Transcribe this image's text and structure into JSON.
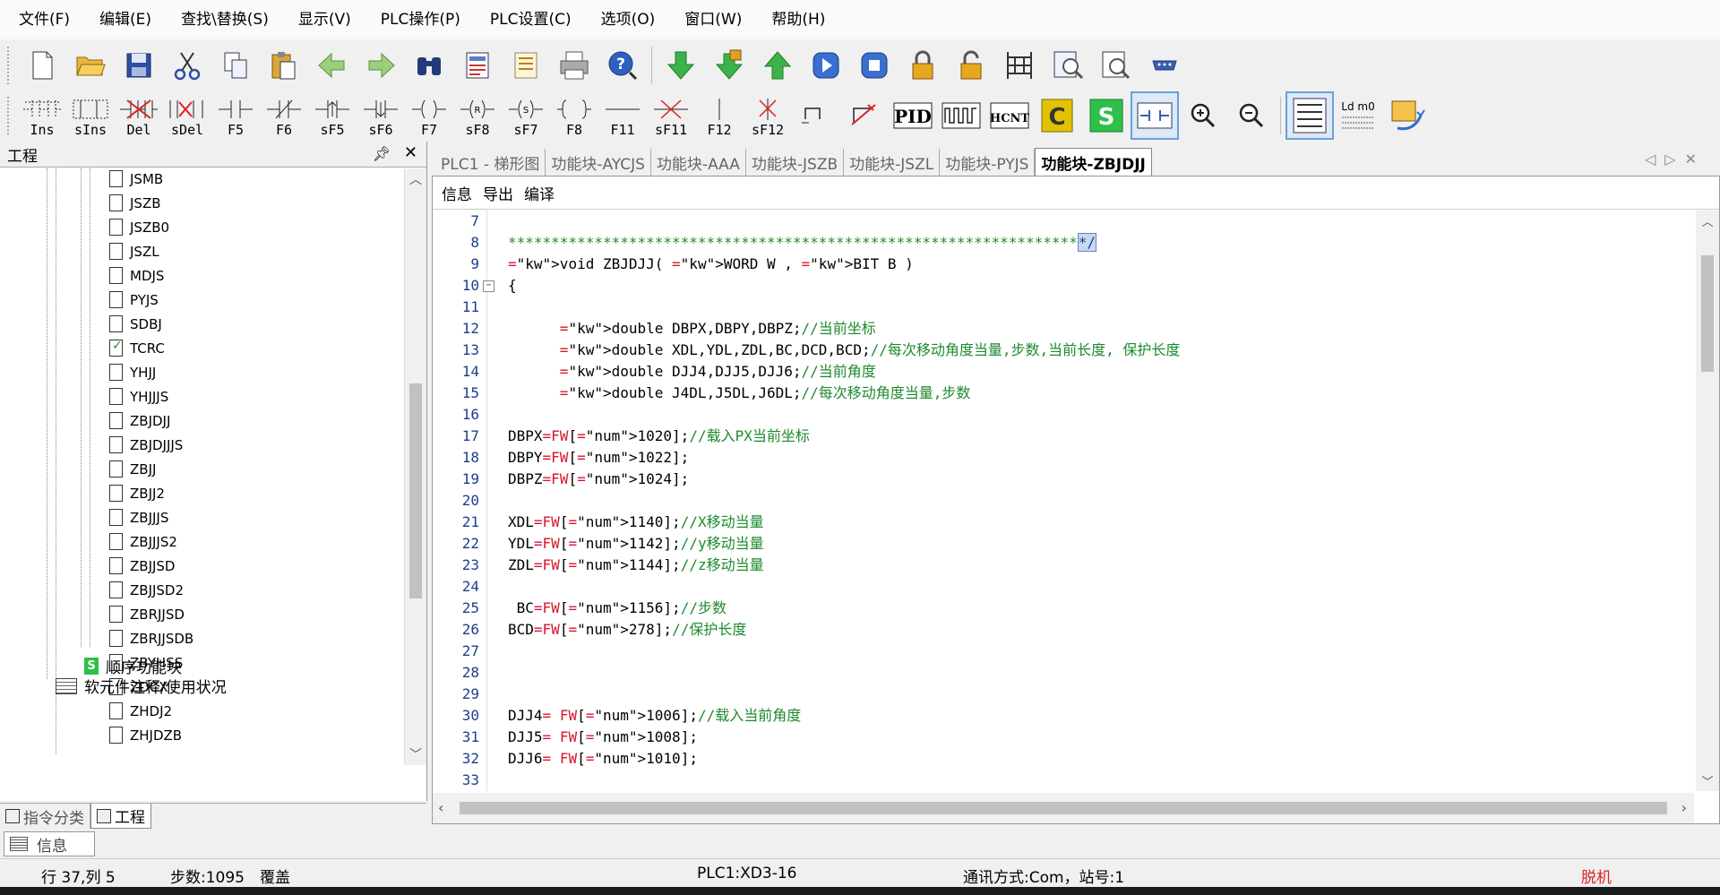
{
  "menu": [
    "文件(F)",
    "编辑(E)",
    "查找\\替换(S)",
    "显示(V)",
    "PLC操作(P)",
    "PLC设置(C)",
    "选项(O)",
    "窗口(W)",
    "帮助(H)"
  ],
  "ladder_keys": [
    "Ins",
    "sIns",
    "Del",
    "sDel",
    "F5",
    "F6",
    "sF5",
    "sF6",
    "F7",
    "sF8",
    "sF7",
    "F8",
    "F11",
    "sF11",
    "F12",
    "sF12"
  ],
  "toolbar2_text": {
    "pid": "PID",
    "hcnt": "HCNT",
    "c": "C",
    "s": "S",
    "ld": "Ld m0"
  },
  "project_panel": {
    "title": "工程",
    "items": [
      "JSMB",
      "JSZB",
      "JSZB0",
      "JSZL",
      "MDJS",
      "PYJS",
      "SDBJ",
      "TCRC",
      "YHJJ",
      "YHJJJS",
      "ZBJDJJ",
      "ZBJDJJJS",
      "ZBJJ",
      "ZBJJ2",
      "ZBJJJS",
      "ZBJJJS2",
      "ZBJJSD",
      "ZBJJSD2",
      "ZBRJJSD",
      "ZBRJJSDB",
      "ZBYHSS",
      "ZDCX",
      "ZHDJ2",
      "ZHJDZB"
    ],
    "seq_block": "顺序功能块",
    "comments": "软元件注释/使用状况",
    "tabs": [
      "指令分类",
      "工程"
    ]
  },
  "doc_tabs": [
    "PLC1 - 梯形图",
    "功能块-AYCJS",
    "功能块-AAA",
    "功能块-JSZB",
    "功能块-JSZL",
    "功能块-PYJS",
    "功能块-ZBJDJJ"
  ],
  "editor_menu": [
    "信息",
    "导出",
    "编译"
  ],
  "code_lines": [
    {
      "n": "7",
      "t": ""
    },
    {
      "n": "8",
      "t": "******************************************************************"
    },
    {
      "n": "9",
      "t": "void ZBJDJJ( WORD W , BIT B )"
    },
    {
      "n": "10",
      "t": "{"
    },
    {
      "n": "11",
      "t": ""
    },
    {
      "n": "12",
      "t": "      double DBPX,DBPY,DBPZ;//当前坐标"
    },
    {
      "n": "13",
      "t": "      double XDL,YDL,ZDL,BC,DCD,BCD;//每次移动角度当量,步数,当前长度, 保护长度"
    },
    {
      "n": "14",
      "t": "      double DJJ4,DJJ5,DJJ6;//当前角度"
    },
    {
      "n": "15",
      "t": "      double J4DL,J5DL,J6DL;//每次移动角度当量,步数"
    },
    {
      "n": "16",
      "t": ""
    },
    {
      "n": "17",
      "t": "DBPX=FW[1020];//载入PX当前坐标"
    },
    {
      "n": "18",
      "t": "DBPY=FW[1022];"
    },
    {
      "n": "19",
      "t": "DBPZ=FW[1024];"
    },
    {
      "n": "20",
      "t": ""
    },
    {
      "n": "21",
      "t": "XDL=FW[1140];//X移动当量"
    },
    {
      "n": "22",
      "t": "YDL=FW[1142];//y移动当量"
    },
    {
      "n": "23",
      "t": "ZDL=FW[1144];//z移动当量"
    },
    {
      "n": "24",
      "t": ""
    },
    {
      "n": "25",
      "t": " BC=FW[1156];//步数"
    },
    {
      "n": "26",
      "t": "BCD=FW[278];//保护长度"
    },
    {
      "n": "27",
      "t": ""
    },
    {
      "n": "28",
      "t": ""
    },
    {
      "n": "29",
      "t": ""
    },
    {
      "n": "30",
      "t": "DJJ4= FW[1006];//载入当前角度"
    },
    {
      "n": "31",
      "t": "DJJ5= FW[1008];"
    },
    {
      "n": "32",
      "t": "DJJ6= FW[1010];"
    },
    {
      "n": "33",
      "t": ""
    }
  ],
  "comment_end": "*/",
  "info_tab": "信息",
  "status": {
    "position": "行 37,列 5",
    "steps": "步数:1095",
    "mode": "覆盖",
    "plc": "PLC1:XD3-16",
    "comm": "通讯方式:Com，站号:1",
    "online": "脱机"
  }
}
